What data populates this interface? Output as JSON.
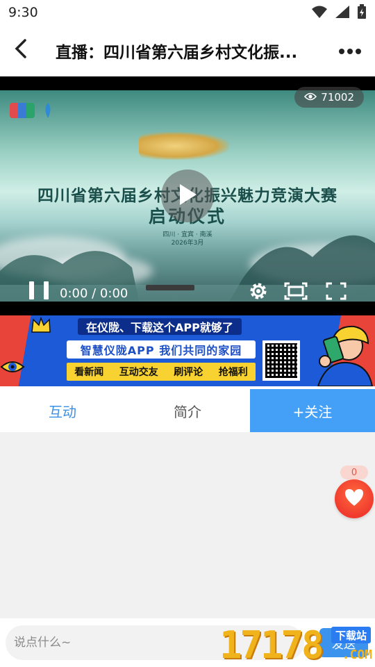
{
  "status_bar": {
    "time": "9:30",
    "icons": [
      "wifi-icon",
      "signal-icon",
      "battery-icon"
    ]
  },
  "nav": {
    "title": "直播：四川省第六届乡村文化振...",
    "icons": [
      "back-arrow-icon",
      "more-dots-icon"
    ]
  },
  "video": {
    "views": "71002",
    "headline": "四川省第六届乡村文化振兴魅力竞演大赛",
    "subheadline": "启动仪式",
    "place": "四川 · 宜宾 · 南溪",
    "date": "2026年3月",
    "time_display": "0:00 / 0:00",
    "controls": [
      "pause-icon",
      "settings-gear-icon",
      "picture-in-picture-icon",
      "fullscreen-icon"
    ]
  },
  "banner": {
    "headline": "在仪陇、下载这个APP就够了",
    "app_line": "智慧仪陇APP  我们共同的家园",
    "features": [
      "看新闻",
      "互动交友",
      "刷评论",
      "抢福利"
    ]
  },
  "tabs": {
    "interact": "互动",
    "intro": "简介",
    "follow": "+关注"
  },
  "likes": {
    "count": "0"
  },
  "comment": {
    "placeholder": "说点什么~",
    "send_label": "发送"
  },
  "watermark": {
    "digits": "17178",
    "tag": "下载站",
    "suffix": ".COM"
  },
  "colors": {
    "accent_blue": "#44a0f6",
    "tab_active_text": "#3a8fe6",
    "like_red": "#f03a2e"
  }
}
